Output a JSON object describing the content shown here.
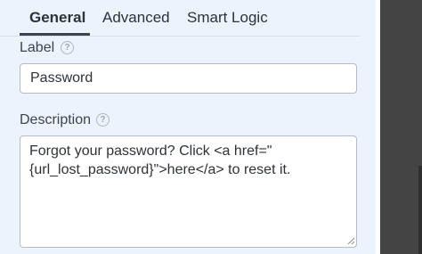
{
  "tabs": [
    {
      "label": "General",
      "active": true
    },
    {
      "label": "Advanced",
      "active": false
    },
    {
      "label": "Smart Logic",
      "active": false
    }
  ],
  "label_field": {
    "title": "Label",
    "help_icon": "question-circle-icon",
    "value": "Password"
  },
  "description_field": {
    "title": "Description",
    "help_icon": "question-circle-icon",
    "value": "Forgot your password? Click <a href=\"\n{url_lost_password}\">here</a> to reset it."
  },
  "colors": {
    "panel_background": "#ebf3fc",
    "text": "#2c3338",
    "input_border": "#b5bcc4",
    "sidebar_rail": "#444444"
  }
}
